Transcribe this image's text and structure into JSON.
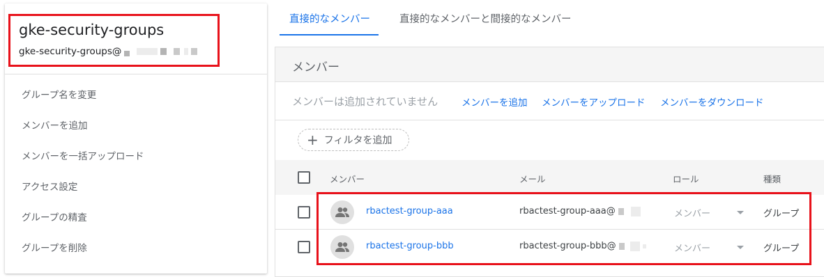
{
  "group": {
    "title": "gke-security-groups",
    "email_prefix": "gke-security-groups@"
  },
  "sidebar": {
    "items": [
      {
        "label": "グループ名を変更"
      },
      {
        "label": "メンバーを追加"
      },
      {
        "label": "メンバーを一括アップロード"
      },
      {
        "label": "アクセス設定"
      },
      {
        "label": "グループの精査"
      },
      {
        "label": "グループを削除"
      }
    ]
  },
  "tabs": [
    {
      "label": "直接的なメンバー",
      "active": true
    },
    {
      "label": "直接的なメンバーと間接的なメンバー",
      "active": false
    }
  ],
  "panel": {
    "title": "メンバー",
    "empty_text": "メンバーは追加されていません",
    "actions": {
      "add": "メンバーを追加",
      "upload": "メンバーをアップロード",
      "download": "メンバーをダウンロード"
    },
    "filter_label": "フィルタを追加"
  },
  "table": {
    "columns": {
      "member": "メンバー",
      "email": "メール",
      "role": "ロール",
      "type": "種類"
    },
    "rows": [
      {
        "name": "rbactest-group-aaa",
        "email_prefix": "rbactest-group-aaa@",
        "role": "メンバー",
        "type": "グループ"
      },
      {
        "name": "rbactest-group-bbb",
        "email_prefix": "rbactest-group-bbb@",
        "role": "メンバー",
        "type": "グループ"
      }
    ]
  },
  "colors": {
    "accent": "#1a73e8",
    "highlight_border": "#e8111a"
  },
  "icons": {
    "avatar": "group-icon",
    "filter": "plus-icon",
    "role_dropdown": "dropdown-arrow-icon"
  }
}
